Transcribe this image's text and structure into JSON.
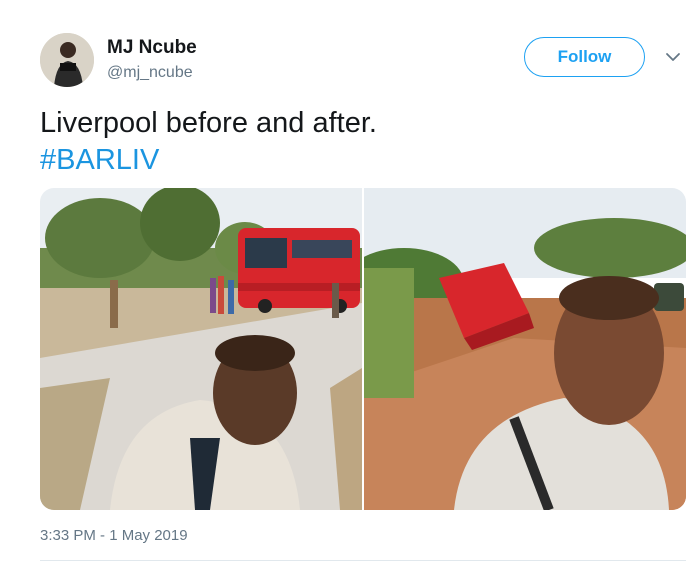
{
  "tweet": {
    "author_name": "MJ Ncube",
    "author_handle": "@mj_ncube",
    "follow_label": "Follow",
    "text": "Liverpool before and after.",
    "hashtag": "#BARLIV",
    "timestamp": "3:33 PM - 1 May 2019"
  },
  "icons": {
    "more_options": "chevron-down-icon"
  },
  "colors": {
    "accent": "#1da1f2",
    "hashtag": "#1b95e0",
    "secondary_text": "#657786",
    "bus_red": "#d8262c"
  }
}
